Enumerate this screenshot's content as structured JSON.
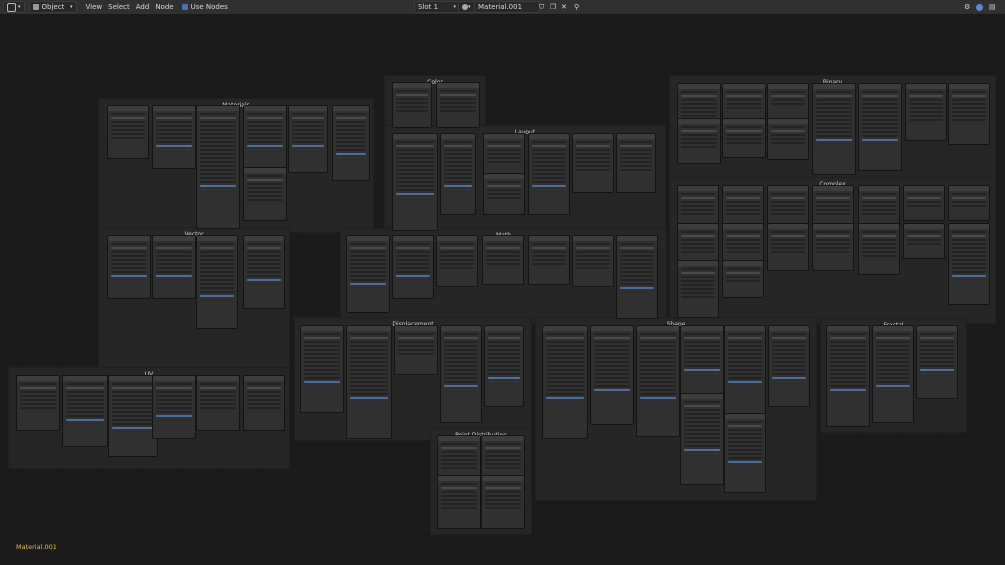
{
  "header": {
    "mode": "Object",
    "menu": [
      "View",
      "Select",
      "Add",
      "Node"
    ],
    "use_nodes_label": "Use Nodes",
    "slot": "Slot 1",
    "material": "Material.001"
  },
  "frames": [
    {
      "key": "materials",
      "title": "Materials"
    },
    {
      "key": "color",
      "title": "Color"
    },
    {
      "key": "binary",
      "title": "Binary"
    },
    {
      "key": "layout",
      "title": "Layout"
    },
    {
      "key": "complex",
      "title": "Complex"
    },
    {
      "key": "vector",
      "title": "Vector"
    },
    {
      "key": "math",
      "title": "Math"
    },
    {
      "key": "displacement",
      "title": "Displacement"
    },
    {
      "key": "shape",
      "title": "Shape"
    },
    {
      "key": "fractal",
      "title": "Fractal"
    },
    {
      "key": "uv",
      "title": "UV"
    },
    {
      "key": "point",
      "title": "Point Distribution"
    }
  ],
  "status": {
    "material_name": "Material.001"
  }
}
